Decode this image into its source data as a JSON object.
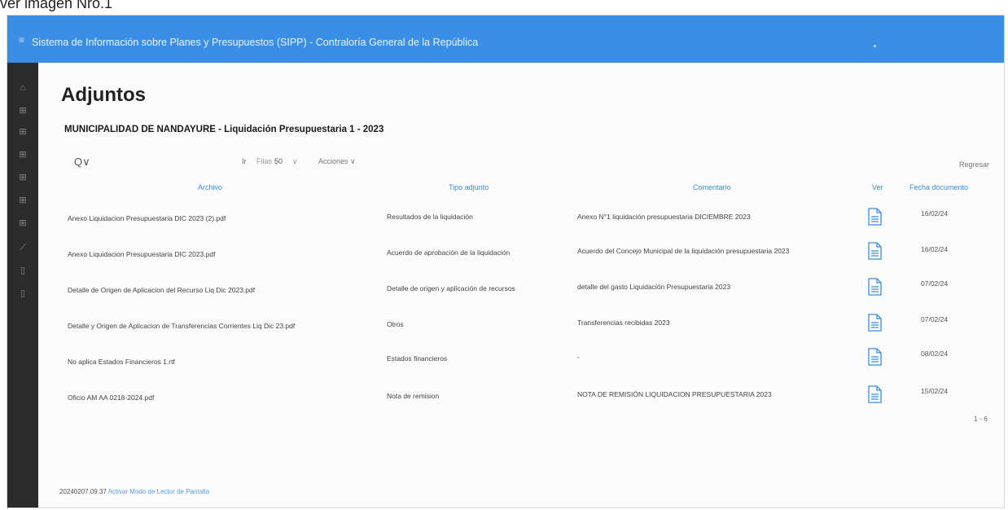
{
  "caption": "ver imagen Nro.1",
  "app_title": "Sistema de Información sobre Planes y Presupuestos (SIPP) - Contraloría General de la República",
  "colors": {
    "topbar": "#3a8ee6",
    "sidebar": "#2b2b2b",
    "accent": "#3b8de0"
  },
  "sidebar_icons": [
    "home-icon",
    "grid-icon",
    "grid-icon",
    "grid-icon",
    "grid-icon",
    "grid-icon",
    "grid-icon",
    "chart-icon",
    "document-icon",
    "document-icon"
  ],
  "page_title": "Adjuntos",
  "subtitle": "MUNICIPALIDAD DE NANDAYURE - Liquidación Presupuestaria 1 - 2023",
  "toolbar": {
    "search_label": "Q∨",
    "go_label": "Ir",
    "rows_label": "Filas",
    "rows_value": "50",
    "actions_label": "Acciones ∨"
  },
  "back_label": "Regresar",
  "columns": {
    "archivo": "Archivo",
    "tipo": "Tipo adjunto",
    "comentario": "Comentario",
    "ver": "Ver",
    "fecha": "Fecha documento"
  },
  "rows": [
    {
      "archivo": "Anexo Liquidacion Presupuestaria DIC 2023 (2).pdf",
      "tipo": "Resultados de la liquidación",
      "comentario": "Anexo N°1 liquidación presupuestaria DICIEMBRE 2023",
      "fecha": "16/02/24"
    },
    {
      "archivo": "Anexo Liquidacion Presupuestaria DIC 2023.pdf",
      "tipo": "Acuerdo de aprobación de la liquidación",
      "comentario": "Acuerdo del Concejo Municipal de la liquidación presupuestaria 2023",
      "fecha": "16/02/24"
    },
    {
      "archivo": "Detalle de Origen de Aplicacion del Recurso Liq Dic 2023.pdf",
      "tipo": "Detalle de origen y aplicación de recursos",
      "comentario": "detalle del gasto Liquidación Presupuestaria 2023",
      "fecha": "07/02/24"
    },
    {
      "archivo": "Detalle y Origen de Aplicacion de Transferencias Corrientes Liq Dic 23.pdf",
      "tipo": "Otros",
      "comentario": "Transferencias recibidas 2023",
      "fecha": "07/02/24"
    },
    {
      "archivo": "No aplica Estados Financieros 1.rtf",
      "tipo": "Estados financieros",
      "comentario": "-",
      "fecha": "08/02/24"
    },
    {
      "archivo": "Oficio AM AA 0218-2024.pdf",
      "tipo": "Nota de remision",
      "comentario": "NOTA DE REMISIÓN LIQUIDACION PRESUPUESTARIA 2023",
      "fecha": "15/02/24"
    }
  ],
  "pagination": "1 - 6",
  "footer": {
    "version": "20240207.09.37",
    "link": "Activar Modo de Lector de Pantalla"
  }
}
